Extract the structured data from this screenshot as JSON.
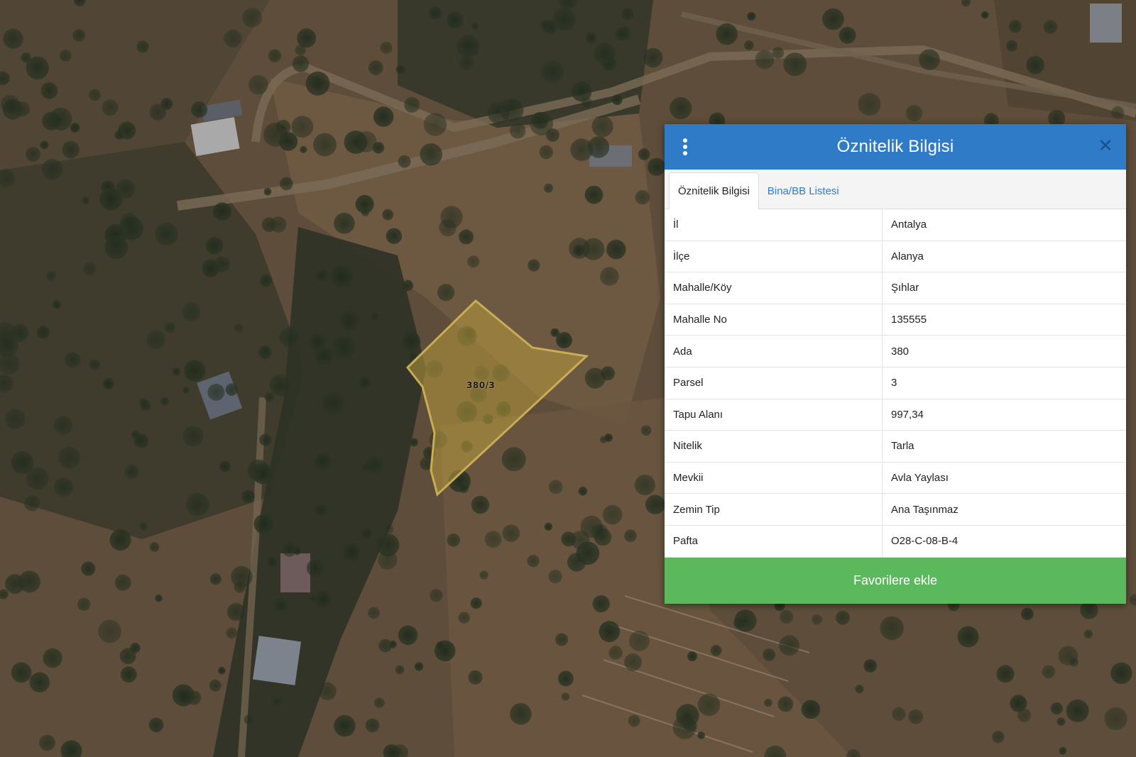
{
  "map": {
    "parcel_label": "380/3",
    "parcel_fill": "#b89a3e",
    "parcel_stroke": "#c9ad55"
  },
  "panel": {
    "title": "Öznitelik Bilgisi",
    "menu_icon": "vertical-ellipsis",
    "close_icon": "close-x",
    "header_color": "#2f7bc8",
    "tabs": [
      {
        "label": "Öznitelik Bilgisi",
        "active": true
      },
      {
        "label": "Bina/BB Listesi",
        "active": false
      }
    ],
    "attributes": [
      {
        "key": "İl",
        "value": "Antalya"
      },
      {
        "key": "İlçe",
        "value": "Alanya"
      },
      {
        "key": "Mahalle/Köy",
        "value": "Şıhlar"
      },
      {
        "key": "Mahalle No",
        "value": "135555"
      },
      {
        "key": "Ada",
        "value": "380"
      },
      {
        "key": "Parsel",
        "value": "3"
      },
      {
        "key": "Tapu Alanı",
        "value": "997,34"
      },
      {
        "key": "Nitelik",
        "value": "Tarla"
      },
      {
        "key": "Mevkii",
        "value": "Avla Yaylası"
      },
      {
        "key": "Zemin Tip",
        "value": "Ana Taşınmaz"
      },
      {
        "key": "Pafta",
        "value": "O28-C-08-B-4"
      }
    ],
    "favorite_button": "Favorilere ekle",
    "favorite_color": "#5cb85c"
  }
}
